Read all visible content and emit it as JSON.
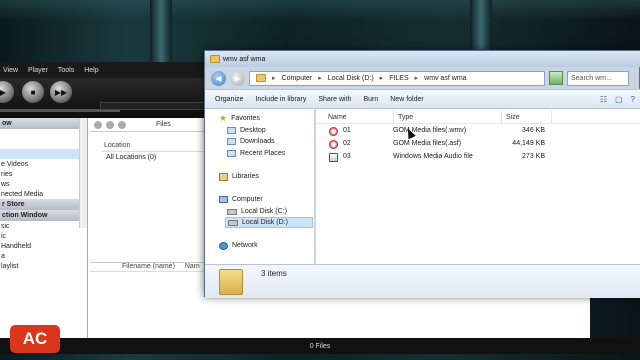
{
  "player": {
    "menu": [
      "View",
      "Player",
      "Tools",
      "Help"
    ],
    "left_header": "ow",
    "left_items": [
      "e Videos",
      "ries",
      "ws",
      "nected Media",
      "r Store"
    ],
    "left_header2": "ction Window",
    "left_items2": [
      "sic",
      "ic",
      "Handheld",
      "a",
      "laylist"
    ],
    "mid_files_label": "Files",
    "location_col": "Location",
    "location_row": "All Locations (0)",
    "filename_col": "Filename (name)",
    "filename_col2": "Nam",
    "status": "0 Files",
    "logo_text": "AC"
  },
  "explorer": {
    "title": "wmv asf wma",
    "breadcrumb": [
      "Computer",
      "Local Disk (D:)",
      "FILES",
      "wmv asf wma"
    ],
    "search_placeholder": "Search wm...",
    "commands": [
      "Organize",
      "Include in library",
      "Share with",
      "Burn",
      "New folder"
    ],
    "nav": {
      "favorites": "Favorites",
      "desktop": "Desktop",
      "downloads": "Downloads",
      "recent": "Recent Places",
      "libraries": "Libraries",
      "computer": "Computer",
      "local_c": "Local Disk (C:)",
      "local_d": "Local Disk (D:)",
      "network": "Network"
    },
    "columns": {
      "name": "Name",
      "type": "Type",
      "size": "Size"
    },
    "files": [
      {
        "name": "01",
        "type": "GOM Media files(.wmv)",
        "size": "346 KB",
        "icon": "gom-media-icon"
      },
      {
        "name": "02",
        "type": "GOM Media files(.asf)",
        "size": "44,149 KB",
        "icon": "gom-media-icon"
      },
      {
        "name": "03",
        "type": "Windows Media Audio file",
        "size": "273 KB",
        "icon": "wma-file-icon"
      }
    ],
    "details_count": "3 items"
  }
}
